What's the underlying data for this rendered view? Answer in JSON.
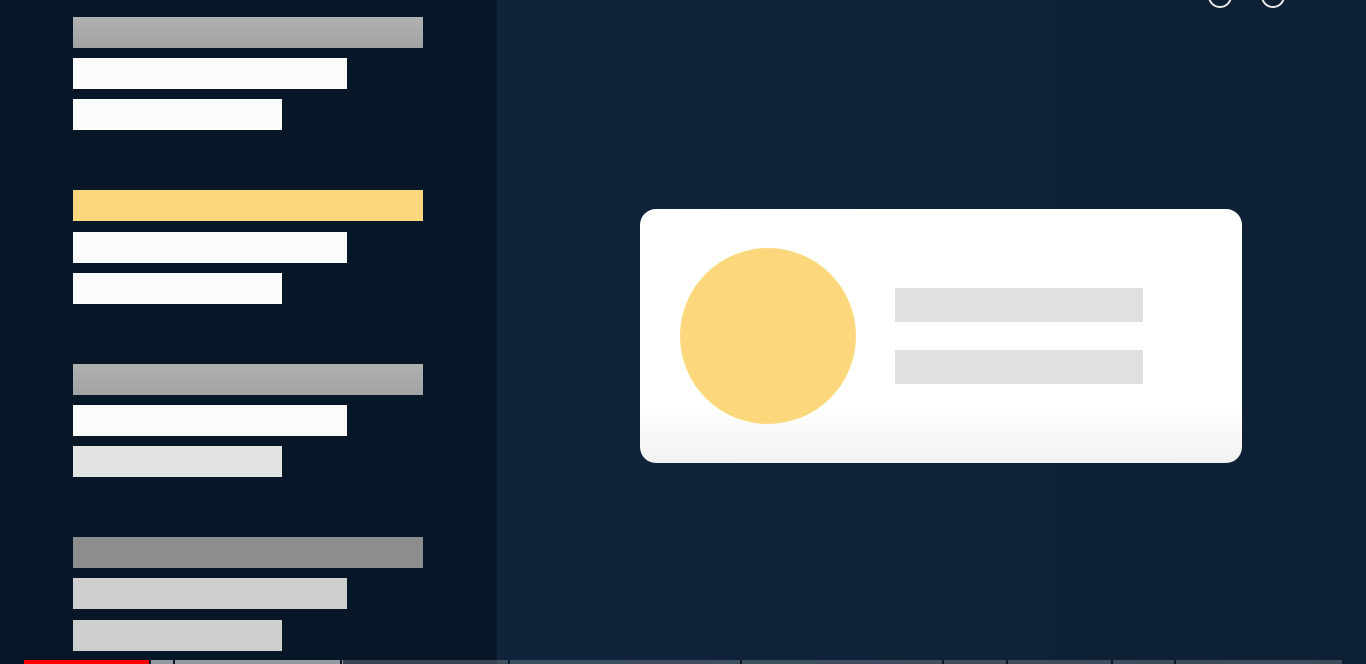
{
  "video": {
    "progress_fraction": 0.095,
    "buffer_fraction": 0.242,
    "accent_color": "#ff0000",
    "yellow_color": "#fcd77e"
  },
  "top_controls": {
    "icons": [
      "settings-circle-icon",
      "info-circle-icon"
    ]
  },
  "left_list": {
    "groups": [
      "group-1",
      "group-2",
      "group-3",
      "group-4"
    ]
  },
  "card": {
    "avatar_color": "#fdd77b"
  }
}
